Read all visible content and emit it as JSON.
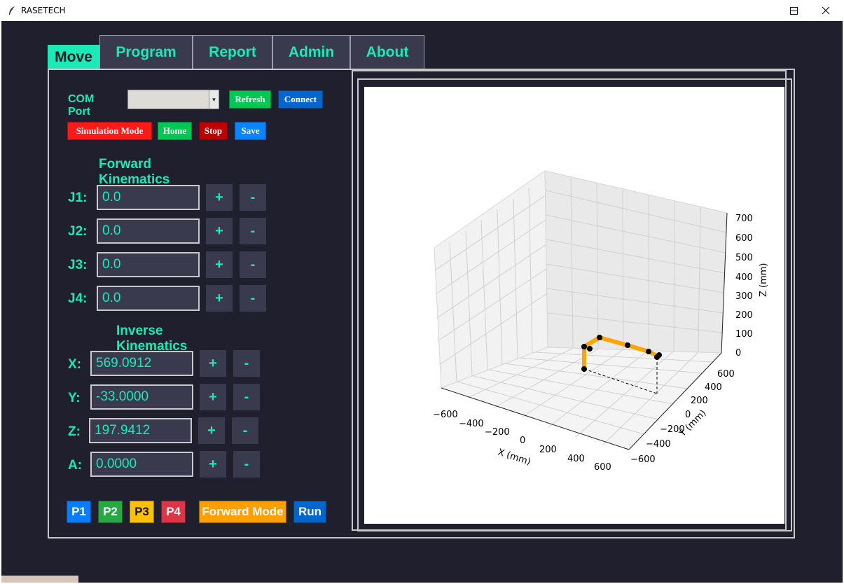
{
  "window": {
    "title": "RASETECH",
    "controls": {
      "minimize": "—",
      "maximize": "☐",
      "close": "✕"
    }
  },
  "tabs": [
    {
      "label": "Move",
      "active": true
    },
    {
      "label": "Program",
      "active": false
    },
    {
      "label": "Report",
      "active": false
    },
    {
      "label": "Admin",
      "active": false
    },
    {
      "label": "About",
      "active": false
    }
  ],
  "connection": {
    "com_port_label": "COM Port",
    "com_port_value": "",
    "refresh_label": "Refresh",
    "connect_label": "Connect"
  },
  "actions": {
    "simulation_label": "Simulation Mode",
    "home_label": "Home",
    "stop_label": "Stop",
    "save_label": "Save"
  },
  "forward": {
    "title": "Forward Kinematics (Degrees)",
    "joints": [
      {
        "label": "J1:",
        "value": "0.0"
      },
      {
        "label": "J2:",
        "value": "0.0"
      },
      {
        "label": "J3:",
        "value": "0.0"
      },
      {
        "label": "J4:",
        "value": "0.0"
      }
    ]
  },
  "inverse": {
    "title": "Inverse Kinematics (mm)",
    "axes": [
      {
        "label": "X:",
        "value": "569.0912"
      },
      {
        "label": "Y:",
        "value": "-33.0000"
      },
      {
        "label": "Z:",
        "value": "197.9412"
      },
      {
        "label": "A:",
        "value": "0.0000"
      }
    ]
  },
  "stepper": {
    "plus": "+",
    "minus": "-"
  },
  "bottom": {
    "p1": "P1",
    "p2": "P2",
    "p3": "P3",
    "p4": "P4",
    "forward_mode": "Forward Mode",
    "run": "Run"
  },
  "colors": {
    "accent": "#1de9b6",
    "background": "#1f1f2e",
    "field": "#3a3a4e",
    "red": "#ff1a1a",
    "green": "#00c853",
    "dark_red": "#c00000",
    "blue": "#0a84ff",
    "connect_blue": "#0066cc",
    "p1": "#0a7cff",
    "p2": "#28a745",
    "p3": "#ffc107",
    "p4": "#dc3545",
    "orange": "#ffa000",
    "arm": "#ffa500"
  },
  "plot": {
    "z_label": "Z (mm)",
    "x_label": "X (mm)",
    "y_label": "Y (mm)",
    "z_ticks": [
      "700",
      "600",
      "500",
      "400",
      "300",
      "200",
      "100",
      "0"
    ],
    "x_ticks": [
      "−600",
      "−400",
      "−200",
      "0",
      "200",
      "400",
      "600"
    ],
    "y_ticks": [
      "600",
      "400",
      "200",
      "0",
      "−200",
      "−400",
      "−600"
    ]
  }
}
